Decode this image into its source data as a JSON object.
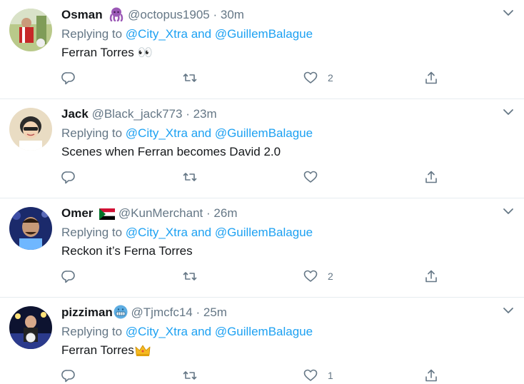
{
  "tweets": [
    {
      "name": "Osman",
      "name_emoji": "octopus-emoji",
      "handle": "@octopus1905",
      "separator": "·",
      "time": "30m",
      "replying_prefix": "Replying to",
      "mention_1": "@City_Xtra",
      "and": "and",
      "mention_2": "@GuillemBalague",
      "text": "Ferran Torres 👀",
      "like_count": "2"
    },
    {
      "name": "Jack",
      "handle": "@Black_jack773",
      "separator": "·",
      "time": "23m",
      "replying_prefix": "Replying to",
      "mention_1": "@City_Xtra",
      "and": "and",
      "mention_2": "@GuillemBalague",
      "text": "Scenes when Ferran becomes David 2.0",
      "like_count": ""
    },
    {
      "name": "Omer",
      "name_emoji": "sudan-flag-emoji",
      "handle": "@KunMerchant",
      "separator": "·",
      "time": "26m",
      "replying_prefix": "Replying to",
      "mention_1": "@City_Xtra",
      "and": "and",
      "mention_2": "@GuillemBalague",
      "text": "Reckon it’s Ferna Torres",
      "like_count": "2"
    },
    {
      "name": "pizziman",
      "name_emoji": "grimace-emoji",
      "handle": "@Tjmcfc14",
      "separator": "·",
      "time": "25m",
      "replying_prefix": "Replying to",
      "mention_1": "@City_Xtra",
      "and": "and",
      "mention_2": "@GuillemBalague",
      "text": "Ferran Torres",
      "text_emoji": "crown-emoji",
      "like_count": "1"
    }
  ],
  "icons": {
    "reply": "reply-icon",
    "retweet": "retweet-icon",
    "like": "like-icon",
    "share": "share-icon",
    "caret": "chevron-down-icon"
  },
  "colors": {
    "link": "#1da1f2",
    "secondary_text": "#657786",
    "primary_text": "#14171a",
    "divider": "#e6ecf0"
  }
}
